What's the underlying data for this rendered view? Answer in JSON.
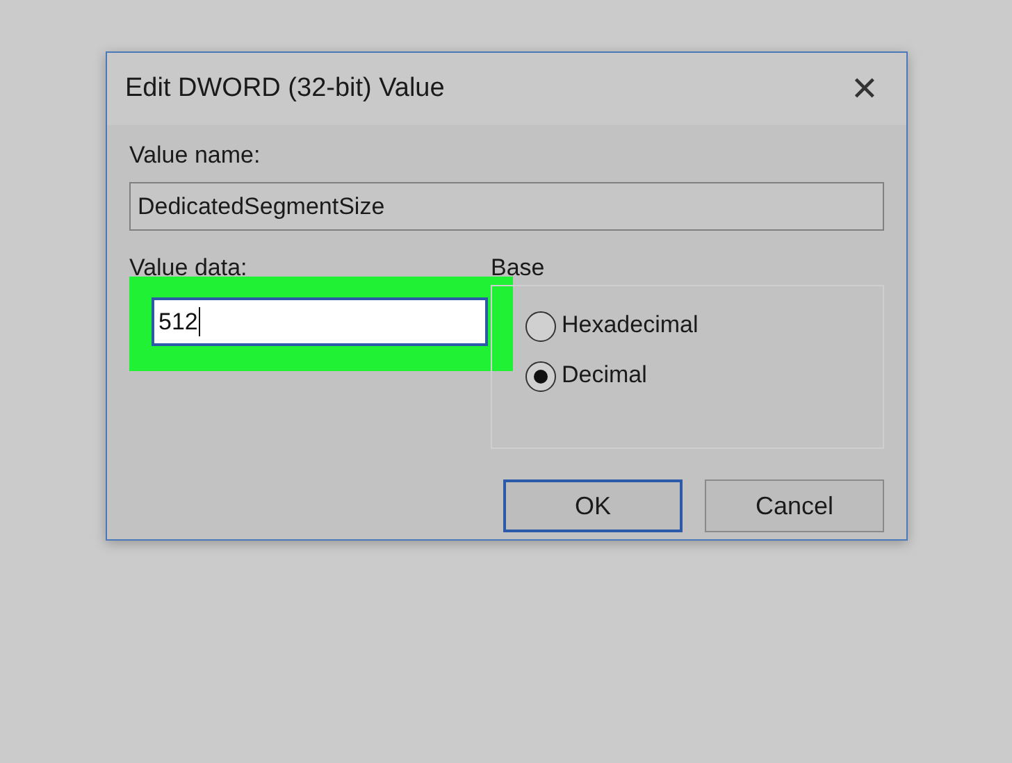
{
  "window": {
    "title": "Edit DWORD (32-bit) Value",
    "close": "✕"
  },
  "value_name": {
    "label": "Value name:",
    "value": "DedicatedSegmentSize"
  },
  "value_data": {
    "label": "Value data:",
    "value": "512"
  },
  "base": {
    "label": "Base",
    "options": [
      {
        "label": "Hexadecimal",
        "selected": false
      },
      {
        "label": "Decimal",
        "selected": true
      }
    ]
  },
  "buttons": [
    {
      "label": "OK",
      "default": true
    },
    {
      "label": "Cancel",
      "default": false
    }
  ]
}
